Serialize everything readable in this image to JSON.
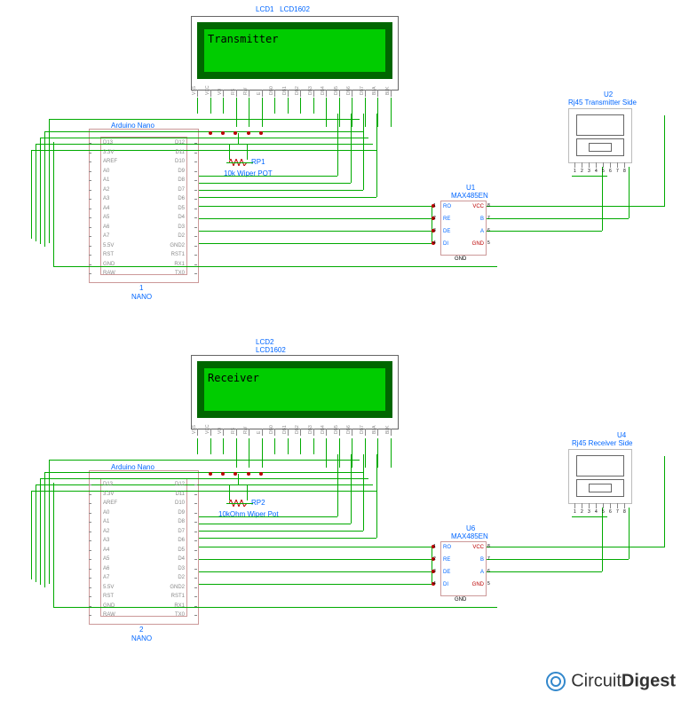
{
  "type": "schematic",
  "circuits": [
    {
      "name": "transmitter",
      "lcd": {
        "ref": "LCD1",
        "part": "LCD1602",
        "text": "Transmitter",
        "pins": [
          "VSS",
          "VCC",
          "VO",
          "RS",
          "RW",
          "E",
          "DB0",
          "DB1",
          "DB2",
          "DB3",
          "DB4",
          "DB5",
          "DB6",
          "DB7",
          "BLA",
          "BLK"
        ]
      },
      "nano": {
        "ref": "1",
        "label": "NANO",
        "title": "Arduino Nano",
        "left": [
          "D13",
          "3.3V",
          "AREF",
          "A0",
          "A1",
          "A2",
          "A3",
          "A4",
          "A5",
          "A6",
          "A7",
          "5.5V",
          "RST",
          "GND",
          "RAW"
        ],
        "right": [
          "D12",
          "D11",
          "D10",
          "D9",
          "D8",
          "D7",
          "D6",
          "D5",
          "D4",
          "D3",
          "D2",
          "GND2",
          "RST1",
          "RX1",
          "TX0"
        ]
      },
      "pot": {
        "ref": "RP1",
        "label": "10k Wiper POT"
      },
      "max": {
        "ref": "U1",
        "part": "MAX485EN",
        "left": [
          "RO",
          "RE",
          "DE",
          "DI"
        ],
        "right": [
          "VCC",
          "B",
          "A",
          "GND"
        ],
        "left_nums": [
          "1",
          "2",
          "3",
          "4"
        ],
        "right_nums": [
          "8",
          "7",
          "6",
          "5"
        ]
      },
      "rj45": {
        "ref": "U2",
        "label": "Rj45 Transmitter Side",
        "pins": [
          "1",
          "2",
          "3",
          "4",
          "5",
          "6",
          "7",
          "8"
        ]
      }
    },
    {
      "name": "receiver",
      "lcd": {
        "ref": "LCD2",
        "part": "LCD1602",
        "text": "Receiver",
        "pins": [
          "VSS",
          "VCC",
          "VO",
          "RS",
          "RW",
          "E",
          "DB0",
          "DB1",
          "DB2",
          "DB3",
          "DB4",
          "DB5",
          "DB6",
          "DB7",
          "BLA",
          "BLK"
        ]
      },
      "nano": {
        "ref": "2",
        "label": "NANO",
        "title": "Arduino Nano",
        "left": [
          "D13",
          "3.3V",
          "AREF",
          "A0",
          "A1",
          "A2",
          "A3",
          "A4",
          "A5",
          "A6",
          "A7",
          "5.5V",
          "RST",
          "GND",
          "RAW"
        ],
        "right": [
          "D12",
          "D11",
          "D10",
          "D9",
          "D8",
          "D7",
          "D6",
          "D5",
          "D4",
          "D3",
          "D2",
          "GND2",
          "RST1",
          "RX1",
          "TX0"
        ]
      },
      "pot": {
        "ref": "RP2",
        "label": "10kOhm Wiper Pot"
      },
      "max": {
        "ref": "U6",
        "part": "MAX485EN",
        "left": [
          "RO",
          "RE",
          "DE",
          "DI"
        ],
        "right": [
          "VCC",
          "B",
          "A",
          "GND"
        ],
        "left_nums": [
          "1",
          "2",
          "3",
          "4"
        ],
        "right_nums": [
          "8",
          "7",
          "6",
          "5"
        ]
      },
      "rj45": {
        "ref": "U4",
        "label": "Rj45 Receiver Side",
        "pins": [
          "1",
          "2",
          "3",
          "4",
          "5",
          "6",
          "7",
          "8"
        ]
      }
    }
  ],
  "logo": {
    "part1": "Circuit",
    "part2": "Digest"
  }
}
